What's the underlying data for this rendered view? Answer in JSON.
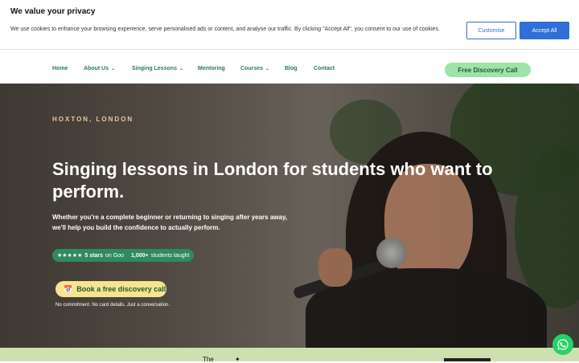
{
  "cookie_banner": {
    "title": "We value your privacy",
    "text": "We use cookies to enhance your browsing experience, serve personalised ads or content, and analyse our traffic. By clicking \"Accept All\", you consent to our use of cookies.",
    "customise_label": "Customise",
    "accept_label": "Accept All"
  },
  "nav": {
    "items": [
      {
        "label": "Home",
        "has_dropdown": false
      },
      {
        "label": "About Us",
        "has_dropdown": true
      },
      {
        "label": "Singing Lessons",
        "has_dropdown": true
      },
      {
        "label": "Mentoring",
        "has_dropdown": false
      },
      {
        "label": "Courses",
        "has_dropdown": true
      },
      {
        "label": "Blog",
        "has_dropdown": false
      },
      {
        "label": "Contact",
        "has_dropdown": false
      }
    ],
    "cta_label": "Free Discovery Call",
    "dropdown_glyph": "⌄"
  },
  "hero": {
    "eyebrow": "HOXTON, LONDON",
    "headline": "Singing lessons in London for students who want to perform.",
    "subtext": "Whether you're a complete beginner or returning to singing after years away, we'll help you build the confidence to actually perform.",
    "badges": [
      {
        "stars": "★★★★★",
        "bold": "5 stars",
        "text": "on Google"
      },
      {
        "stars": "",
        "bold": "1,000+",
        "text": "students taught"
      }
    ],
    "cta_label": "Book a free discovery call",
    "cta_icon": "📅",
    "fine_print": "No commitment. No card details. Just a conversation."
  },
  "strip": {
    "the_text": "The"
  },
  "colors": {
    "accent_green": "#2a7a57",
    "cta_green": "#9ee3a8",
    "cta_yellow": "#f7e48e",
    "cookie_blue": "#2f6fd6",
    "badge_green": "#2e8b5f",
    "whatsapp": "#25d366"
  }
}
